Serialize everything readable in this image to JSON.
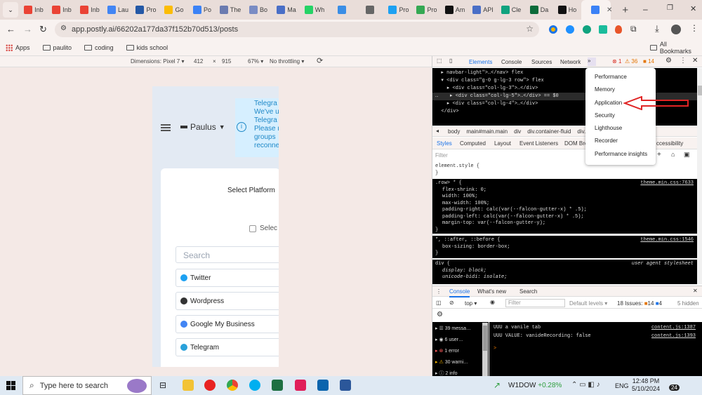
{
  "browser": {
    "tabs": [
      {
        "label": "Inb",
        "color": "#ea4335"
      },
      {
        "label": "Inb",
        "color": "#ea4335"
      },
      {
        "label": "Inb",
        "color": "#ea4335"
      },
      {
        "label": "Lau",
        "color": "#4285f4"
      },
      {
        "label": "Pro",
        "color": "#2458a6"
      },
      {
        "label": "Go",
        "color": "#fbbc04"
      },
      {
        "label": "Po",
        "color": "#3b82f6"
      },
      {
        "label": "The",
        "color": "#6b7bb0"
      },
      {
        "label": "Bo",
        "color": "#7a8cc4"
      },
      {
        "label": "Ma",
        "color": "#4a6fc7"
      },
      {
        "label": "Wh",
        "color": "#25d366"
      },
      {
        "label": "",
        "color": "#3a8ee6"
      },
      {
        "label": "",
        "color": "#666"
      },
      {
        "label": "Pro",
        "color": "#1da1f2"
      },
      {
        "label": "Pro",
        "color": "#34a853"
      },
      {
        "label": "Am",
        "color": "#111"
      },
      {
        "label": "API",
        "color": "#4a6fc7"
      },
      {
        "label": "Cle",
        "color": "#10a37f"
      },
      {
        "label": "Da",
        "color": "#0b6b3a"
      },
      {
        "label": "Ho",
        "color": "#111"
      },
      {
        "label": "",
        "color": "#3b82f6"
      }
    ],
    "url": "app.postly.ai/66202a177da37f152b70d513/posts",
    "bookmarks": [
      "Apps",
      "paulito",
      "coding",
      "kids school"
    ],
    "all_bookmarks": "All Bookmarks"
  },
  "device_toolbar": {
    "dimensions_label": "Dimensions: Pixel 7",
    "width": "412",
    "height": "915",
    "zoom": "67%",
    "throttling": "No throttling"
  },
  "page": {
    "user_name": "Paulus",
    "notice_lines": [
      "Telegra",
      "We've u",
      "Telegra",
      "Please r",
      "groups",
      "reconne"
    ],
    "select_platform": "Select Platform",
    "select_all": "Selec",
    "search_placeholder": "Search",
    "platforms": [
      {
        "name": "Twitter",
        "icon": "twitter-icon",
        "color": "#1da1f2"
      },
      {
        "name": "Wordpress",
        "icon": "wordpress-icon",
        "color": "#333"
      },
      {
        "name": "Google My Business",
        "icon": "google-my-business-icon",
        "color": "#4285f4"
      },
      {
        "name": "Telegram",
        "icon": "telegram-icon",
        "color": "#2aa1da"
      }
    ]
  },
  "devtools": {
    "tabs": [
      "Elements",
      "Console",
      "Sources",
      "Network"
    ],
    "errors": "1",
    "warnings": "36",
    "issues": "14",
    "elements_lines": [
      "  ▸ navbar-light\">…</nav> flex",
      "  ▾ <div class=\"g-0 g-lg-3 row\"> flex",
      "    ▸ <div class=\"col-lg-3\">…</div>",
      "…    ▸ <div class=\"col-lg-5\">…</div> == $0",
      "    ▸ <div class=\"col-lg-4\">…</div>",
      "  </div>"
    ],
    "breadcrumbs": [
      "body",
      "main#main.main",
      "div",
      "div.container-fluid",
      "div.",
      "div.col-lg-5"
    ],
    "subtabs": [
      "Styles",
      "Computed",
      "Layout",
      "Event Listeners",
      "DOM Bre",
      "ccessibility"
    ],
    "filter_placeholder": "Filter",
    "element_style": "element.style {",
    "close_brace": "}",
    "row_rule_selector": ".row> * {",
    "row_rule_source": "theme.min.css:7633",
    "row_rule_props": [
      "flex-shrink: 0;",
      "width: 100%;",
      "max-width: 100%;",
      "padding-right: calc(var(--falcon-gutter-x) * .5);",
      "padding-left: calc(var(--falcon-gutter-x) * .5);",
      "margin-top: var(--falcon-gutter-y);"
    ],
    "after_rule_selector": "*, ::after, ::before {",
    "after_rule_source": "theme.min.css:1546",
    "after_rule_props": [
      "box-sizing: border-box;"
    ],
    "div_rule_selector": "div {",
    "div_rule_source": "user agent stylesheet",
    "div_rule_props": [
      "display: block;",
      "unicode-bidi: isolate;"
    ],
    "more_menu": [
      "Performance",
      "Memory",
      "Application",
      "Security",
      "Lighthouse",
      "Recorder",
      "Performance insights"
    ],
    "drawer_tabs": [
      "Console",
      "What's new",
      "Search"
    ],
    "console_context": "top",
    "console_filter_placeholder": "Filter",
    "default_levels": "Default levels",
    "issues_count": "18 Issues:",
    "issues_a": "14",
    "issues_b": "4",
    "hidden": "5 hidden",
    "sidebar_items": [
      "39 messa…",
      "6 user…",
      "1 error",
      "30 warni…",
      "2 info"
    ],
    "console_lines": [
      {
        "text": "UUU a vanile tab",
        "source": "content.js:1387"
      },
      {
        "text": "UUU VALUE: vanideRecording: false",
        "source": "content.js:1393"
      }
    ],
    "prompt": ">"
  },
  "taskbar": {
    "search_placeholder": "Type here to search",
    "stock_name": "W1DOW",
    "stock_change": "+0.28%",
    "lang": "ENG",
    "time": "12:48 PM",
    "date": "5/10/2024",
    "notif_count": "24"
  }
}
